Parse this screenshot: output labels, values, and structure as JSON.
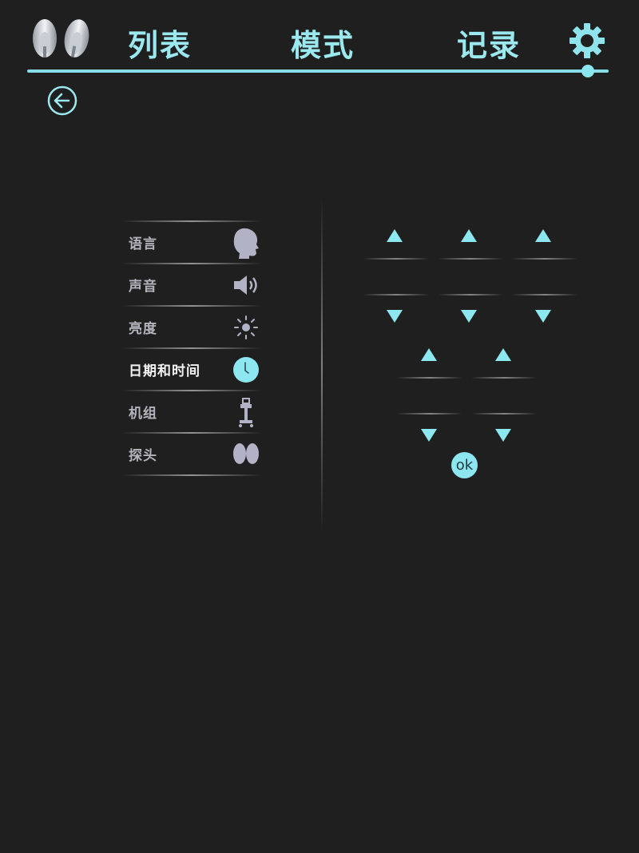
{
  "header": {
    "tabs": [
      {
        "label": "列表"
      },
      {
        "label": "模式"
      },
      {
        "label": "记录"
      }
    ],
    "accent_color": "#9be8ef"
  },
  "settings_menu": {
    "items": [
      {
        "label": "语言",
        "icon": "head-icon"
      },
      {
        "label": "声音",
        "icon": "speaker-icon"
      },
      {
        "label": "亮度",
        "icon": "brightness-icon"
      },
      {
        "label": "日期和时间",
        "icon": "clock-icon",
        "active": true
      },
      {
        "label": "机组",
        "icon": "cart-unit-icon"
      },
      {
        "label": "探头",
        "icon": "probe-icon"
      }
    ]
  },
  "datetime_panel": {
    "ok_label": "ok"
  }
}
